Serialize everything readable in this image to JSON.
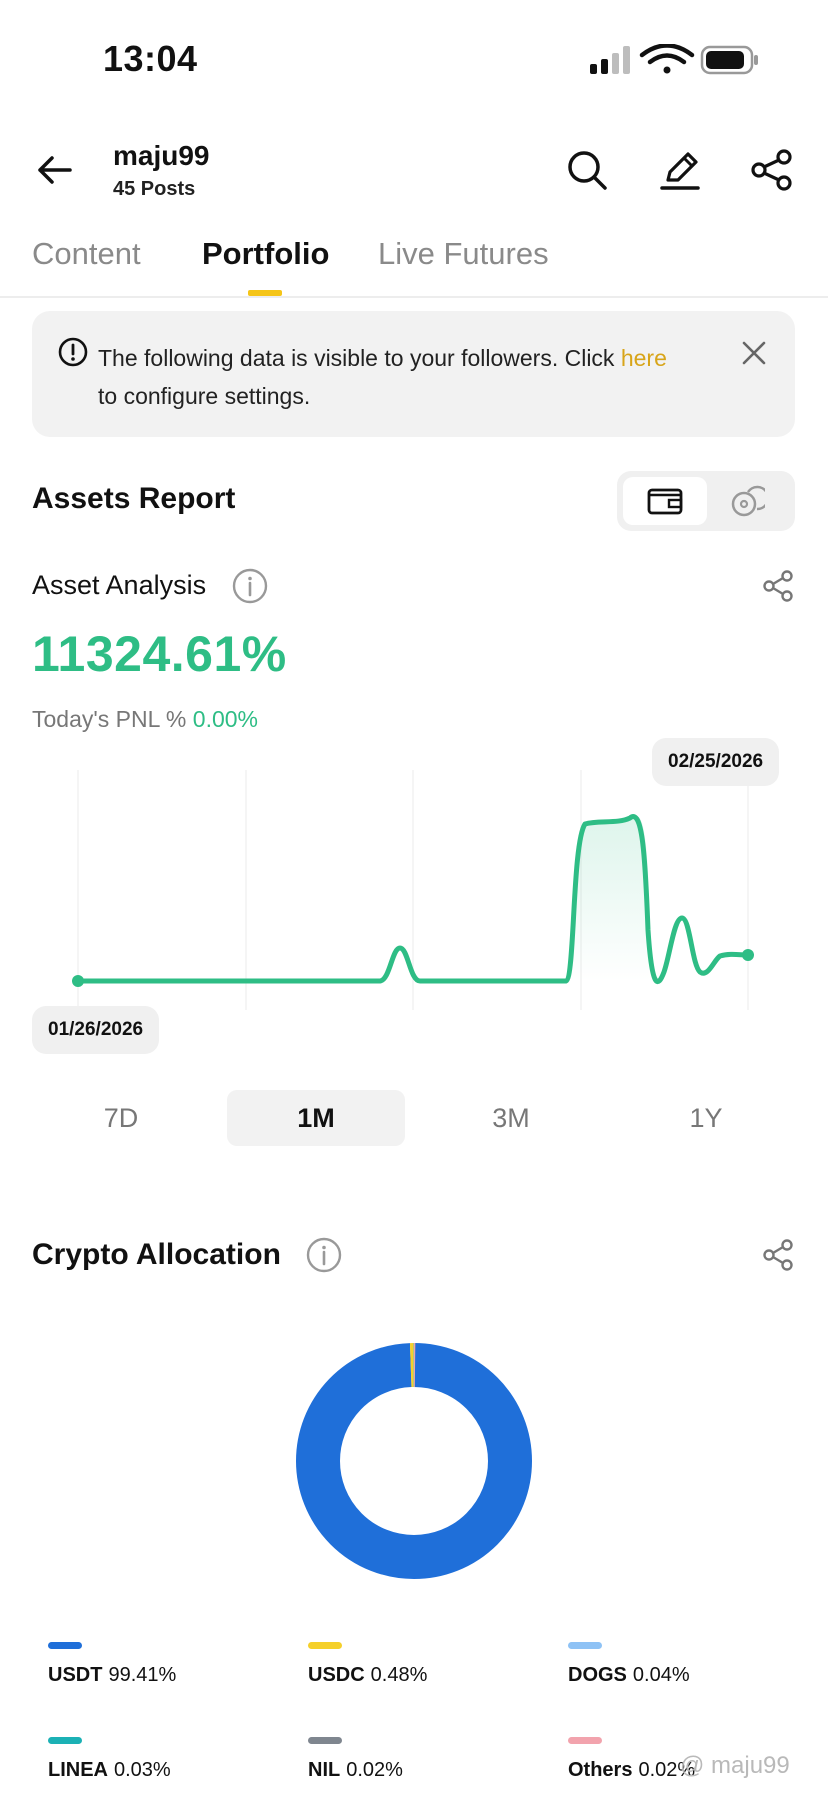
{
  "status_bar": {
    "time": "13:04"
  },
  "header": {
    "username": "maju99",
    "posts": "45 Posts"
  },
  "tabs": [
    {
      "label": "Content"
    },
    {
      "label": "Portfolio"
    },
    {
      "label": "Live Futures"
    }
  ],
  "notice": {
    "text_before": "The following data is visible to your followers. Click ",
    "link": "here",
    "text_after": "to configure settings."
  },
  "assets_report": {
    "title": "Assets Report"
  },
  "asset_analysis": {
    "title": "Asset Analysis",
    "total_pct": "11324.61%",
    "pnl_label": "Today's PNL %",
    "pnl_value": "0.00%"
  },
  "chart_data": {
    "type": "line",
    "start_label": "01/26/2026",
    "end_label": "02/25/2026",
    "x": [
      "01/26/2026",
      "02/25/2026"
    ],
    "note_color": "#2ebd85"
  },
  "ranges": [
    {
      "label": "7D"
    },
    {
      "label": "1M"
    },
    {
      "label": "3M"
    },
    {
      "label": "1Y"
    }
  ],
  "crypto_allocation": {
    "title": "Crypto Allocation",
    "items": [
      {
        "name": "USDT",
        "pct": "99.41%",
        "color": "#1f6fd9",
        "value": 99.41
      },
      {
        "name": "USDC",
        "pct": "0.48%",
        "color": "#f5d02a",
        "value": 0.48
      },
      {
        "name": "DOGS",
        "pct": "0.04%",
        "color": "#8ec2f5",
        "value": 0.04
      },
      {
        "name": "LINEA",
        "pct": "0.03%",
        "color": "#1bb1b5",
        "value": 0.03
      },
      {
        "name": "NIL",
        "pct": "0.02%",
        "color": "#7f868f",
        "value": 0.02
      },
      {
        "name": "Others",
        "pct": "0.02%",
        "color": "#f2a3ad",
        "value": 0.02
      }
    ]
  },
  "watermark": "@ maju99"
}
